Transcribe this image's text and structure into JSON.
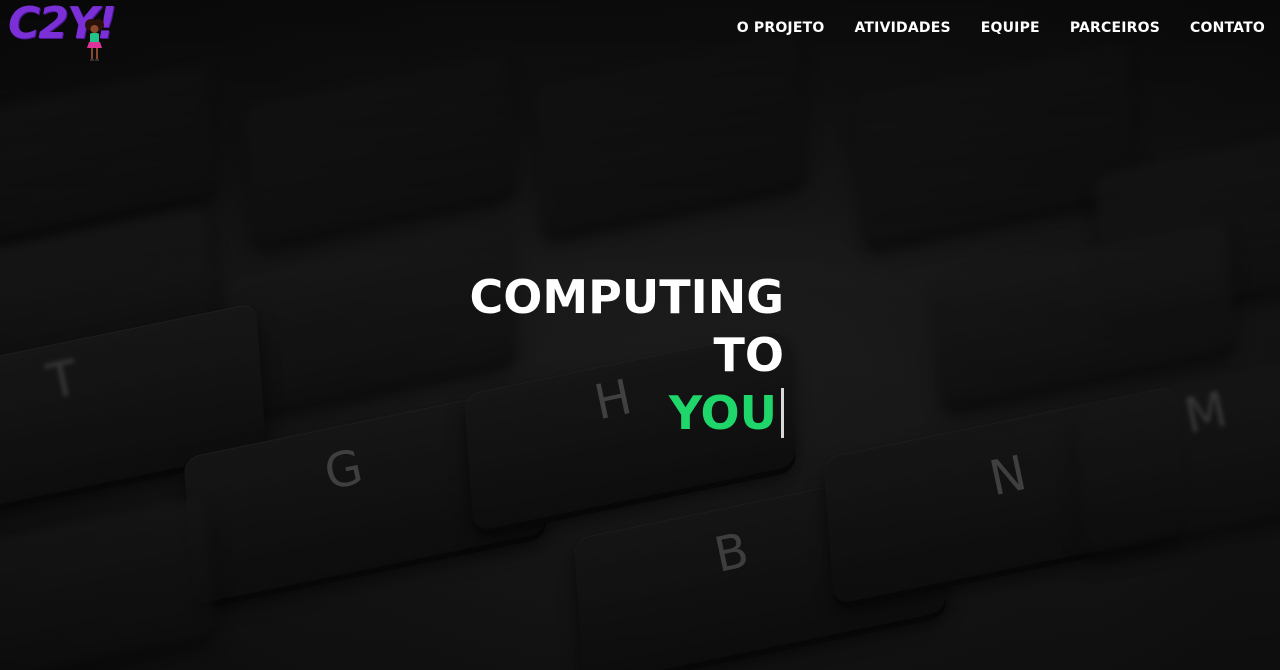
{
  "brand": {
    "logo_text": "C2Y!",
    "accent_color": "#7b2fd6"
  },
  "nav": {
    "items": [
      {
        "label": "O PROJETO"
      },
      {
        "label": "ATIVIDADES"
      },
      {
        "label": "EQUIPE"
      },
      {
        "label": "PARCEIROS"
      },
      {
        "label": "CONTATO"
      }
    ]
  },
  "hero": {
    "line1": "COMPUTING",
    "line2": "TO",
    "line3": "YOU",
    "highlight_color": "#1fd66b",
    "background": "keyboard-photo",
    "keycap_letters": [
      "T",
      "G",
      "H",
      "N",
      "B",
      "M"
    ]
  }
}
